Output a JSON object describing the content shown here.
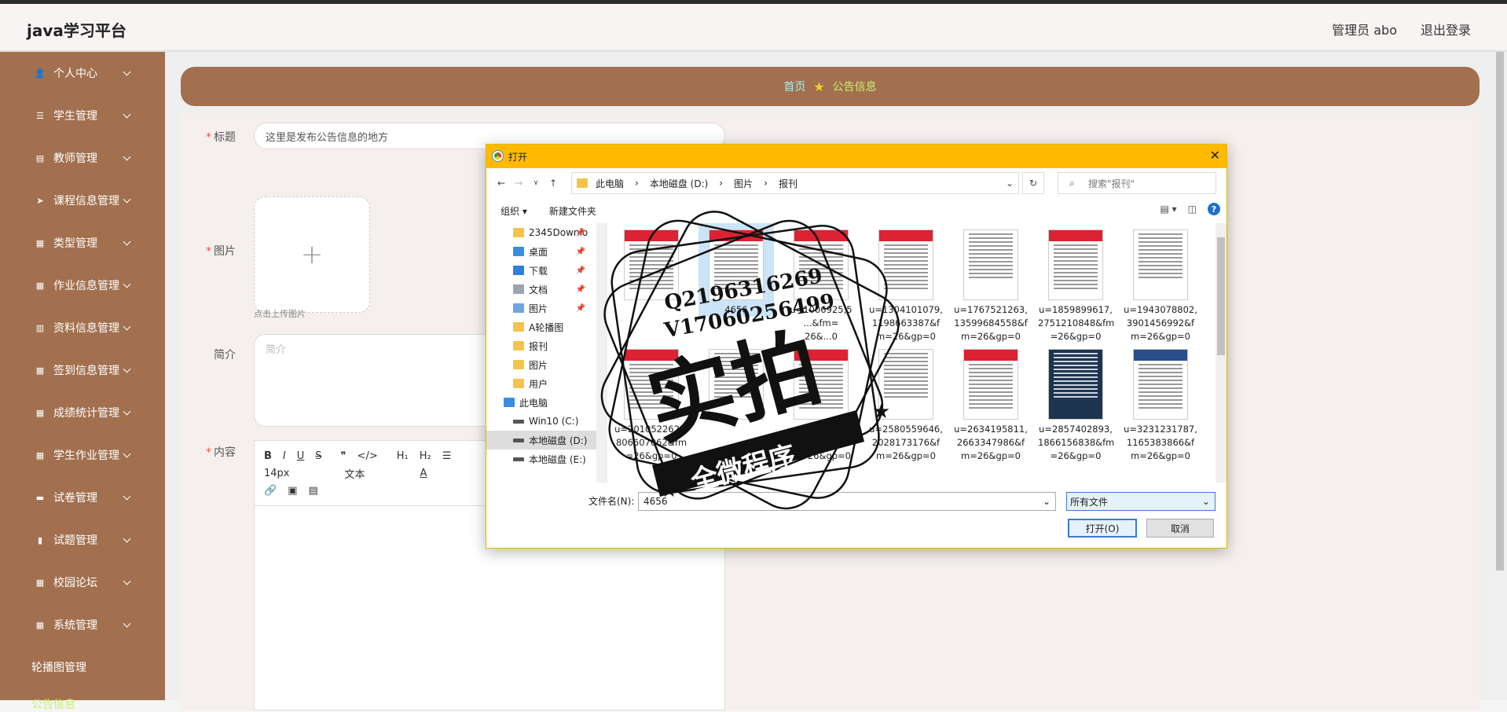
{
  "header": {
    "brand": "java学习平台",
    "user": "管理员 abo",
    "logout": "退出登录"
  },
  "sidebar": {
    "items": [
      {
        "label": "个人中心",
        "icon": "user-icon"
      },
      {
        "label": "学生管理",
        "icon": "list-icon"
      },
      {
        "label": "教师管理",
        "icon": "card-icon"
      },
      {
        "label": "课程信息管理",
        "icon": "send-icon"
      },
      {
        "label": "类型管理",
        "icon": "grid-icon"
      },
      {
        "label": "作业信息管理",
        "icon": "grid-icon"
      },
      {
        "label": "资料信息管理",
        "icon": "clipboard-icon"
      },
      {
        "label": "签到信息管理",
        "icon": "grid-icon"
      },
      {
        "label": "成绩统计管理",
        "icon": "grid-icon"
      },
      {
        "label": "学生作业管理",
        "icon": "grid-icon"
      },
      {
        "label": "试卷管理",
        "icon": "monitor-icon"
      },
      {
        "label": "试题管理",
        "icon": "bar-icon"
      },
      {
        "label": "校园论坛",
        "icon": "grid-icon"
      },
      {
        "label": "系统管理",
        "icon": "grid-icon"
      }
    ],
    "plain": "轮播图管理",
    "active": "公告信息"
  },
  "breadcrumb": {
    "home": "首页",
    "current": "公告信息"
  },
  "form": {
    "title_label": "标题",
    "title_value": "这里是发布公告信息的地方",
    "image_label": "图片",
    "upload_hint": "点击上传图片",
    "intro_label": "简介",
    "intro_placeholder": "简介",
    "content_label": "内容",
    "font_size": "14px",
    "text_style": "文本"
  },
  "dialog": {
    "title": "打开",
    "path": [
      "此电脑",
      "本地磁盘 (D:)",
      "图片",
      "报刊"
    ],
    "search_placeholder": "搜索\"报刊\"",
    "organize": "组织 ▾",
    "new_folder": "新建文件夹",
    "tree": [
      {
        "label": "2345Downlo",
        "type": "folder",
        "pinned": true
      },
      {
        "label": "桌面",
        "type": "desktop",
        "pinned": true
      },
      {
        "label": "下载",
        "type": "download",
        "pinned": true
      },
      {
        "label": "文档",
        "type": "doc",
        "pinned": true
      },
      {
        "label": "图片",
        "type": "pic",
        "pinned": true
      },
      {
        "label": "A轮播图",
        "type": "folder",
        "pinned": false
      },
      {
        "label": "报刊",
        "type": "folder",
        "pinned": false
      },
      {
        "label": "图片",
        "type": "folder",
        "pinned": false
      },
      {
        "label": "用户",
        "type": "folder",
        "pinned": false
      },
      {
        "label": "此电脑",
        "type": "pc",
        "pinned": false
      },
      {
        "label": "Win10 (C:)",
        "type": "drive",
        "pinned": false
      },
      {
        "label": "本地磁盘 (D:)",
        "type": "drive",
        "pinned": false
      },
      {
        "label": "本地磁盘 (E:)",
        "type": "drive",
        "pinned": false
      }
    ],
    "files_row1": [
      {
        "name": "",
        "style": "red"
      },
      {
        "name": "4656",
        "style": "red"
      },
      {
        "name": "u=1006925,5\n...&fm=\n26&...0",
        "style": "red"
      },
      {
        "name": "u=1304101079,\n1198663387&f\nm=26&gp=0",
        "style": "red"
      },
      {
        "name": "u=1767521263,\n13599684558&f\nm=26&gp=0",
        "style": "plain"
      },
      {
        "name": "u=1859899617,\n2751210848&fm\n=26&gp=0",
        "style": "red"
      },
      {
        "name": "u=1943078802,\n3901456992&f\nm=26&gp=0",
        "style": "plain"
      }
    ],
    "files_row2": [
      {
        "name": "u=2010522626,\n806607062&fm\n=26&gp=0",
        "style": "red"
      },
      {
        "name": "",
        "style": "plain"
      },
      {
        "name": "...1\n...0080&f\nm=26&gp=0",
        "style": "red"
      },
      {
        "name": "u=2580559646,\n2028173176&f\nm=26&gp=0",
        "style": "plain"
      },
      {
        "name": "u=2634195811,\n2663347986&f\nm=26&gp=0",
        "style": "red"
      },
      {
        "name": "u=2857402893,\n1866156838&fm\n=26&gp=0",
        "style": "dark"
      },
      {
        "name": "u=3231231787,\n1165383866&f\nm=26&gp=0",
        "style": "blue"
      }
    ],
    "filename_label": "文件名(N):",
    "filename_value": "4656",
    "filetype": "所有文件",
    "open_button": "打开(O)",
    "cancel_button": "取消"
  },
  "watermark": {
    "line1": "Q2196316269",
    "line2": "V17060256499",
    "big": "实拍",
    "band": "全微程序"
  }
}
